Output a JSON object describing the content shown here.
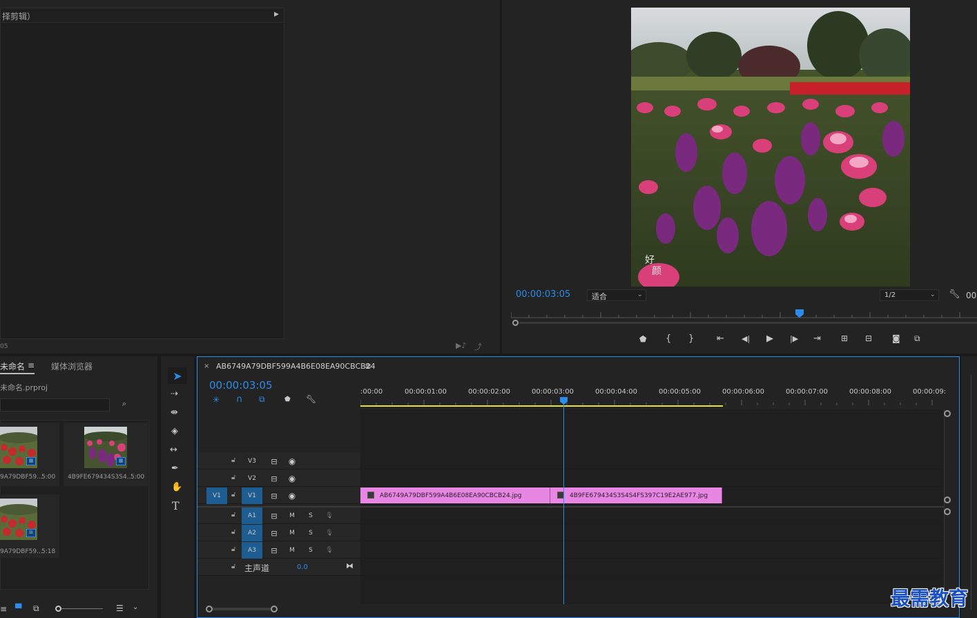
{
  "source": {
    "header_text": "择剪辑）",
    "bottom_left_text": "05"
  },
  "program": {
    "timecode": "00:00:03:05",
    "zoom_select": "适合",
    "resolution_select": "1/2",
    "right_partial": "00",
    "frame_overlay_text": "好\n颜"
  },
  "project": {
    "tab_project": "未命名",
    "tab_media_browser": "媒体浏览器",
    "project_file": "未命名.prproj",
    "search_placeholder": "",
    "items": [
      {
        "name": "9A79DBF59...",
        "duration": "5:00"
      },
      {
        "name": "4B9FE679434S3S4...",
        "duration": "5:00"
      },
      {
        "name": "9A79DBF59...",
        "duration": "5:18"
      }
    ]
  },
  "timeline": {
    "sequence_name": "AB6749A79DBF599A4B6E08EA90CBCB24",
    "timecode": "00:00:03:05",
    "ruler": [
      ":00:00",
      "00:00:01:00",
      "00:00:02:00",
      "00:00:03:00",
      "00:00:04:00",
      "00:00:05:00",
      "00:00:06:00",
      "00:00:07:00",
      "00:00:08:00",
      "00:00:09:"
    ],
    "video_tracks": [
      "V3",
      "V2",
      "V1"
    ],
    "source_patch": "V1",
    "audio_tracks": [
      "A1",
      "A2",
      "A3"
    ],
    "mute_label": "M",
    "solo_label": "S",
    "master_label": "主声道",
    "master_value": "0.0",
    "clips": [
      {
        "name": "AB6749A79DBF599A4B6E08EA90CBCB24.jpg"
      },
      {
        "name": "4B9FE679434S3S4S4FS397C19E2AE977.jpg"
      }
    ]
  },
  "tools": {
    "type_tool": "T"
  },
  "watermark": "最需教育",
  "colors": {
    "accent": "#2d8ceb",
    "clip": "#e887e3",
    "track_on": "#1d5d91",
    "work_area": "#e8e02a"
  }
}
